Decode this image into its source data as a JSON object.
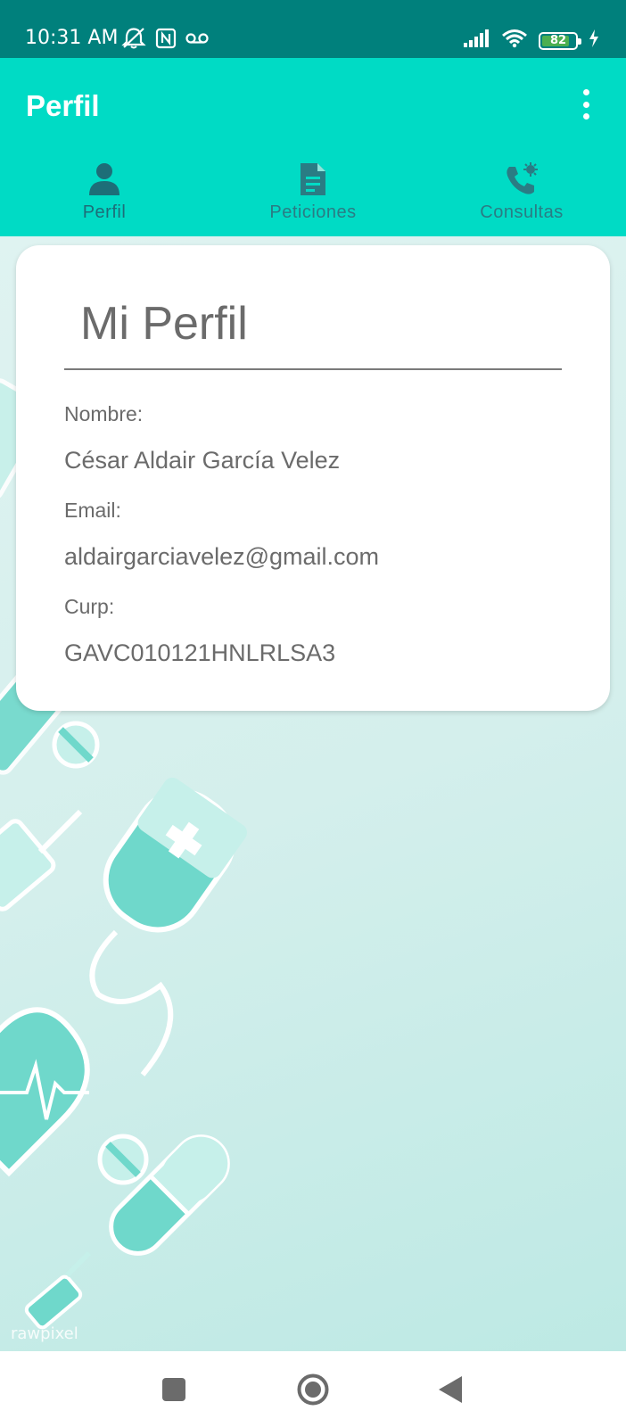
{
  "status_bar": {
    "time": "10:31 AM",
    "battery_level": 82,
    "battery_label": "82",
    "icons": [
      "muted-alarm-icon",
      "nfc-icon",
      "voicemail-icon",
      "signal-icon",
      "wifi-icon",
      "battery-icon",
      "charging-icon"
    ]
  },
  "app_bar": {
    "title": "Perfil",
    "menu_icon": "overflow-menu-icon"
  },
  "tabs": [
    {
      "label": "Perfil",
      "icon": "person-icon",
      "active": true
    },
    {
      "label": "Peticiones",
      "icon": "document-icon",
      "active": false
    },
    {
      "label": "Consultas",
      "icon": "phone-virus-icon",
      "active": false
    }
  ],
  "profile": {
    "title": "Mi Perfil",
    "name_label": "Nombre:",
    "name_value": "César Aldair García Velez",
    "email_label": "Email:",
    "email_value": "aldairgarciavelez@gmail.com",
    "curp_label": "Curp:",
    "curp_value": "GAVC010121HNLRLSA3"
  },
  "background": {
    "watermark": "rawpixel"
  },
  "colors": {
    "status_bar": "#00807c",
    "app_bar": "#00dbc5",
    "tab_text": "#2a7c84",
    "card_text": "#6b6b6b",
    "illustration": "#6fd8cb"
  },
  "nav_bar": {
    "icons": [
      "recents-square-icon",
      "home-circle-icon",
      "back-triangle-icon"
    ]
  }
}
